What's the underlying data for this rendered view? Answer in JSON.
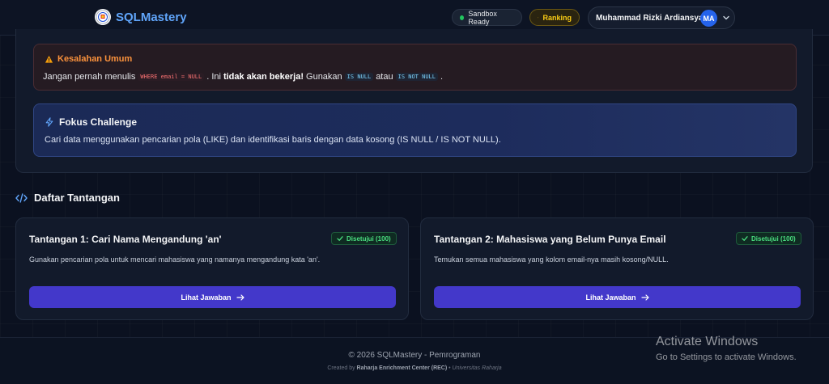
{
  "header": {
    "brand": "SQLMastery",
    "sandbox_label": "Sandbox Ready",
    "ranking_label": "Ranking",
    "user_name": "Muhammad Rizki Ardiansyah",
    "user_initials": "MA"
  },
  "warning": {
    "title": "Kesalahan Umum",
    "text_1": "Jangan pernah menulis",
    "code_bad": "WHERE email = NULL",
    "text_2": ". Ini",
    "bold": "tidak akan bekerja!",
    "text_3": "Gunakan",
    "code_1": "IS NULL",
    "text_4": "atau",
    "code_2": "IS NOT NULL",
    "text_5": "."
  },
  "focus": {
    "title": "Fokus Challenge",
    "text": "Cari data menggunakan pencarian pola (LIKE) dan identifikasi baris dengan data kosong (IS NULL / IS NOT NULL)."
  },
  "section": {
    "title": "Daftar Tantangan"
  },
  "challenges": [
    {
      "title": "Tantangan 1: Cari Nama Mengandung 'an'",
      "badge": "Disetujui (100)",
      "description": "Gunakan pencarian pola untuk mencari mahasiswa yang namanya mengandung kata 'an'.",
      "button": "Lihat Jawaban"
    },
    {
      "title": "Tantangan 2: Mahasiswa yang Belum Punya Email",
      "badge": "Disetujui (100)",
      "description": "Temukan semua mahasiswa yang kolom email-nya masih kosong/NULL.",
      "button": "Lihat Jawaban"
    }
  ],
  "footer": {
    "copyright": "© 2026 SQLMastery - Pemrograman",
    "credit_prefix": "Created by",
    "credit_org": "Raharja Enrichment Center (REC)",
    "credit_sep": "•",
    "credit_univ": "Universitas Raharja"
  },
  "watermark": {
    "title": "Activate Windows",
    "subtitle": "Go to Settings to activate Windows."
  },
  "colors": {
    "background": "#0b1120",
    "brand": "#60a5fa",
    "primary_button": "#4338ca",
    "success": "#4ade80",
    "warning": "#fb923c",
    "ranking": "#facc15"
  },
  "icons": {
    "warning": "warning-triangle-icon",
    "focus": "lightning-icon",
    "section": "code-icon",
    "badge": "check-icon",
    "button": "arrow-right-icon",
    "user_menu": "chevron-down-icon"
  }
}
